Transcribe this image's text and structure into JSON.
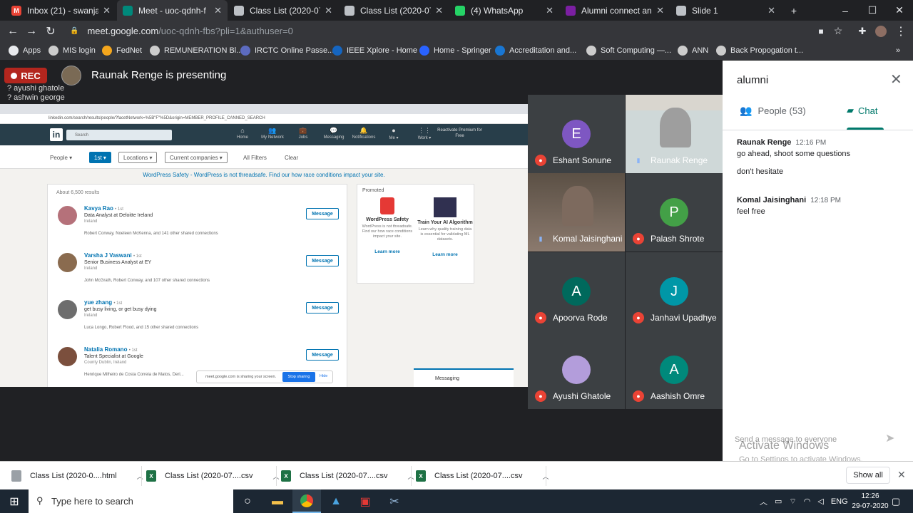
{
  "tabs": [
    {
      "label": "Inbox (21) - swanjari@",
      "color": "#ea4335",
      "glyph": "M",
      "active": false
    },
    {
      "label": "Meet - uoc-qdnh-f",
      "color": "#00897b",
      "glyph": "",
      "active": true
    },
    {
      "label": "Class List (2020-07-29)",
      "color": "#bdc1c6",
      "glyph": "",
      "active": false
    },
    {
      "label": "Class List (2020-07-29)",
      "color": "#bdc1c6",
      "glyph": "",
      "active": false
    },
    {
      "label": "(4) WhatsApp",
      "color": "#25d366",
      "glyph": "",
      "active": false
    },
    {
      "label": "Alumni connect and A",
      "color": "#7b1fa2",
      "glyph": "",
      "active": false
    },
    {
      "label": "Slide 1",
      "color": "#bdc1c6",
      "glyph": "",
      "active": false
    }
  ],
  "new_tab_label": "+",
  "window": {
    "minimize": "–",
    "maximize": "☐",
    "close": "✕"
  },
  "toolbar": {
    "back": "←",
    "forward": "→",
    "reload": "↻",
    "url_host": "meet.google.com",
    "url_path": "/uoc-qdnh-fbs?pli=1&authuser=0"
  },
  "bookmarks": [
    {
      "label": "Apps",
      "icon": "apps-icon"
    },
    {
      "label": "MIS login",
      "icon": "globe-icon"
    },
    {
      "label": "FedNet",
      "icon": "fednet-icon"
    },
    {
      "label": "REMUNERATION Bl...",
      "icon": "globe-icon"
    },
    {
      "label": "IRCTC Online Passe...",
      "icon": "irctc-icon"
    },
    {
      "label": "IEEE Xplore - Home",
      "icon": "ieee-icon"
    },
    {
      "label": "Home - Springer",
      "icon": "springer-icon"
    },
    {
      "label": "Accreditation and...",
      "icon": "s-icon"
    },
    {
      "label": "Soft Computing —...",
      "icon": "globe-icon"
    },
    {
      "label": "ANN",
      "icon": "globe-icon"
    },
    {
      "label": "Back Propogation t...",
      "icon": "globe-icon"
    }
  ],
  "meet": {
    "rec": "REC",
    "presenter": "Raunak Renge is presenting",
    "attendees_overlay": [
      "? ayushi ghatole",
      "? ashwin george"
    ]
  },
  "shared_screen": {
    "url": "linkedin.com/search/results/people/?facetNetwork=%5B\"F\"%5D&origin=MEMBER_PROFILE_CANNED_SEARCH",
    "search_placeholder": "Search",
    "nav": [
      {
        "label": "Home",
        "icon": "⌂"
      },
      {
        "label": "My Network",
        "icon": "👥"
      },
      {
        "label": "Jobs",
        "icon": "💼"
      },
      {
        "label": "Messaging",
        "icon": "💬"
      },
      {
        "label": "Notifications",
        "icon": "🔔"
      },
      {
        "label": "Me ▾",
        "icon": "●"
      },
      {
        "label": "Work ▾",
        "icon": "⋮⋮"
      }
    ],
    "reactivate": "Reactivate Premium for Free",
    "filters": {
      "people": "People ▾",
      "first": "1st ▾",
      "locations": "Locations ▾",
      "companies": "Current companies ▾",
      "all": "All Filters",
      "clear": "Clear"
    },
    "ad": "WordPress Safety - WordPress is not threadsafe. Find our how race conditions impact your site.",
    "results_count": "About 6,500 results",
    "results": [
      {
        "name": "Kavya Rao",
        "degree": "• 1st",
        "title": "Data Analyst at Deloitte Ireland",
        "loc": "Ireland",
        "shared": "Robert Conway, Noeleen McKenna, and 141 other shared connections",
        "avatar": "#b5717a"
      },
      {
        "name": "Varsha J Vaswani",
        "degree": "• 1st",
        "title": "Senior Business Analyst at EY",
        "loc": "Ireland",
        "shared": "John McGrath, Robert Conway, and 107 other shared connections",
        "avatar": "#8a6b4f"
      },
      {
        "name": "yue zhang",
        "degree": "• 1st",
        "title": "get busy living, or get busy dying",
        "loc": "Ireland",
        "shared": "Luca Longo, Robert Flood, and 15 other shared connections",
        "avatar": "#6d6d6d"
      },
      {
        "name": "Natalia Romano",
        "degree": "• 1st",
        "title": "Talent Specialist at Google",
        "loc": "County Dublin, Ireland",
        "shared": "Henrique Milheiro de Costa Correia de Matos, Deri...",
        "avatar": "#7b4f3d"
      }
    ],
    "message_label": "Message",
    "promoted": "Promoted",
    "promos": [
      {
        "title": "WordPress Safety",
        "desc": "WordPress is not threadsafe. Find our how race conditions impact your site.",
        "link": "Learn more"
      },
      {
        "title": "Train Your AI Algorithm",
        "desc": "Learn why quality training data is essential for validating ML datasets.",
        "link": "Learn more"
      }
    ],
    "sharing": "meet.google.com is sharing your screen.",
    "stop_sharing": "Stop sharing",
    "hide": "Hide",
    "messaging": "Messaging"
  },
  "participants": [
    {
      "name": "Eshant Sonune",
      "initial": "E",
      "color": "#7e57c2",
      "muted": true,
      "video": false
    },
    {
      "name": "Raunak Renge",
      "initial": "",
      "color": "#9e9e9e",
      "muted": false,
      "video": true
    },
    {
      "name": "Komal Jaisinghani",
      "initial": "",
      "color": "#7d6a5e",
      "muted": false,
      "video": true
    },
    {
      "name": "Palash Shrote",
      "initial": "P",
      "color": "#43a047",
      "muted": true,
      "video": false
    },
    {
      "name": "Apoorva Rode",
      "initial": "A",
      "color": "#00695c",
      "muted": true,
      "video": false
    },
    {
      "name": "Janhavi Upadhye",
      "initial": "J",
      "color": "#0097a7",
      "muted": true,
      "video": false
    },
    {
      "name": "Ayushi Ghatole",
      "initial": "",
      "color": "#b39ddb",
      "muted": true,
      "video": false
    },
    {
      "name": "Aashish Omre",
      "initial": "A",
      "color": "#00897b",
      "muted": true,
      "video": false
    }
  ],
  "panel": {
    "title": "alumni",
    "close": "✕",
    "people_tab": "People (53)",
    "chat_tab": "Chat",
    "messages": [
      {
        "sender": "Raunak Renge",
        "time": "12:16 PM",
        "lines": [
          "go ahead, shoot some questions",
          "don't hesitate"
        ]
      },
      {
        "sender": "Komal Jaisinghani",
        "time": "12:18 PM",
        "lines": [
          "feel free"
        ]
      }
    ],
    "send_placeholder": "Send a message to everyone",
    "send_icon": "➤"
  },
  "watermark": {
    "line1": "Activate Windows",
    "line2": "Go to Settings to activate Windows."
  },
  "downloads": [
    {
      "label": "Class List (2020-0....html",
      "type": "chrome-file-icon"
    },
    {
      "label": "Class List (2020-07....csv",
      "type": "excel-icon"
    },
    {
      "label": "Class List (2020-07....csv",
      "type": "excel-icon"
    },
    {
      "label": "Class List (2020-07....csv",
      "type": "excel-icon"
    }
  ],
  "show_all": "Show all",
  "taskbar": {
    "search": "Type here to search",
    "tray": "ENG",
    "time": "12:26",
    "date": "29-07-2020"
  }
}
